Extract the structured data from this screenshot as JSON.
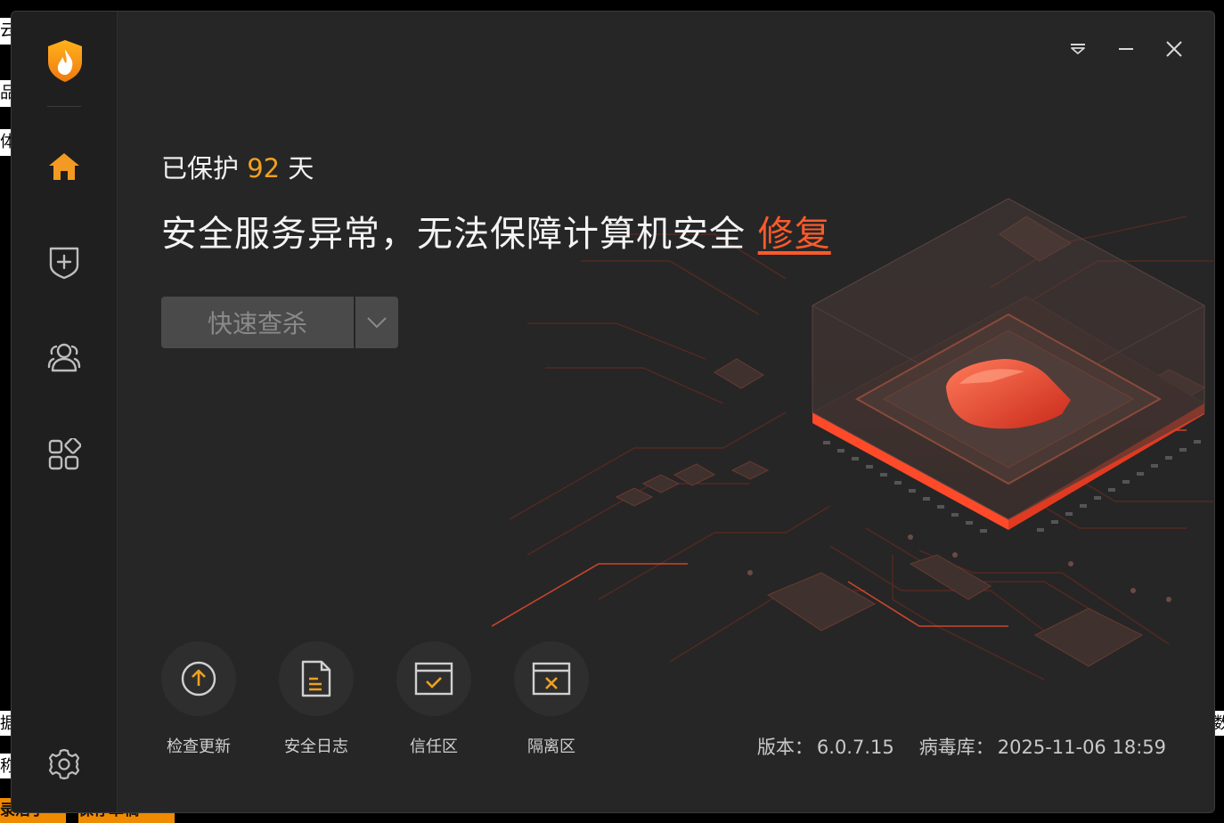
{
  "window_controls": {
    "menu_icon": "dropdown-menu-icon",
    "minimize_icon": "minimize-icon",
    "close_icon": "close-icon"
  },
  "sidebar": {
    "items": [
      {
        "name": "home",
        "icon": "home-icon",
        "active": true
      },
      {
        "name": "protection",
        "icon": "shield-plus-icon",
        "active": false
      },
      {
        "name": "users",
        "icon": "users-icon",
        "active": false
      },
      {
        "name": "apps",
        "icon": "apps-grid-icon",
        "active": false
      }
    ],
    "settings_icon": "gear-icon"
  },
  "protection": {
    "prefix": "已保护",
    "days": "92",
    "suffix": "天"
  },
  "status": {
    "message": "安全服务异常，无法保障计算机安全",
    "fix_label": "修复"
  },
  "scan": {
    "label": "快速查杀"
  },
  "tools": [
    {
      "label": "检查更新",
      "icon": "update-arrow-icon"
    },
    {
      "label": "安全日志",
      "icon": "log-document-icon"
    },
    {
      "label": "信任区",
      "icon": "trust-zone-icon"
    },
    {
      "label": "隔离区",
      "icon": "quarantine-icon"
    }
  ],
  "version": {
    "version_label": "版本：",
    "version_value": "6.0.7.15",
    "db_label": "病毒库：",
    "db_value": "2025-11-06 18:59"
  },
  "background_app": {
    "left_chars": [
      "云",
      "品",
      "体",
      "据",
      "称"
    ],
    "right_chars": [
      "数"
    ],
    "buttons": [
      "录活了",
      "保存草稿"
    ]
  },
  "colors": {
    "accent_orange": "#f0a020",
    "alert_red": "#ff5a2a",
    "window_bg": "#262626",
    "sidebar_bg": "#1f1f1f"
  }
}
